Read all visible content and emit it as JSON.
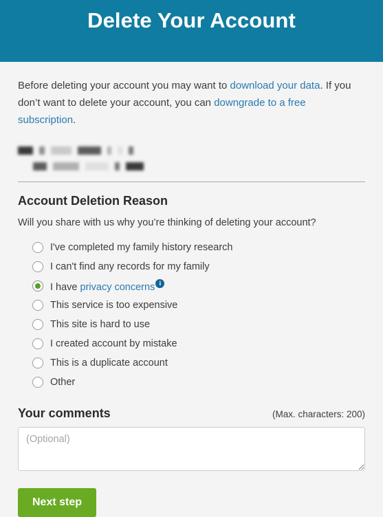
{
  "header": {
    "title": "Delete Your Account",
    "background_color": "#117ca1"
  },
  "intro": {
    "text_before_first_link": "Before deleting your account you may want to ",
    "first_link": "download your data",
    "text_between_links": ". If you don’t want to delete your account, you can ",
    "second_link": "downgrade to a free subscription",
    "text_after": ".",
    "link_color": "#2a7ab0"
  },
  "redacted": {
    "description": "redacted-account-details",
    "lines": [
      [
        22,
        8,
        30,
        34,
        6,
        7,
        7
      ],
      [
        20,
        38,
        34,
        7,
        26
      ]
    ]
  },
  "section": {
    "heading": "Account Deletion Reason",
    "question": "Will you share with us why you’re thinking of deleting your account?"
  },
  "radio_options": [
    {
      "label": "I've completed my family history research",
      "selected": false,
      "link": null,
      "info": false
    },
    {
      "label": "I can't find any records for my family",
      "selected": false,
      "link": null,
      "info": false
    },
    {
      "label": "I have ",
      "selected": true,
      "link": "privacy concerns",
      "info": true
    },
    {
      "label": "This service is too expensive",
      "selected": false,
      "link": null,
      "info": false
    },
    {
      "label": "This site is hard to use",
      "selected": false,
      "link": null,
      "info": false
    },
    {
      "label": "I created account by mistake",
      "selected": false,
      "link": null,
      "info": false
    },
    {
      "label": "This is a duplicate account",
      "selected": false,
      "link": null,
      "info": false
    },
    {
      "label": "Other",
      "selected": false,
      "link": null,
      "info": false
    }
  ],
  "selected_radio_color": "#54a224",
  "info_icon_glyph": "i",
  "comments": {
    "title": "Your comments",
    "max_chars_label": "(Max. characters: 200)",
    "placeholder": "(Optional)",
    "value": ""
  },
  "actions": {
    "next_label": "Next step",
    "next_color": "#69ab22"
  }
}
